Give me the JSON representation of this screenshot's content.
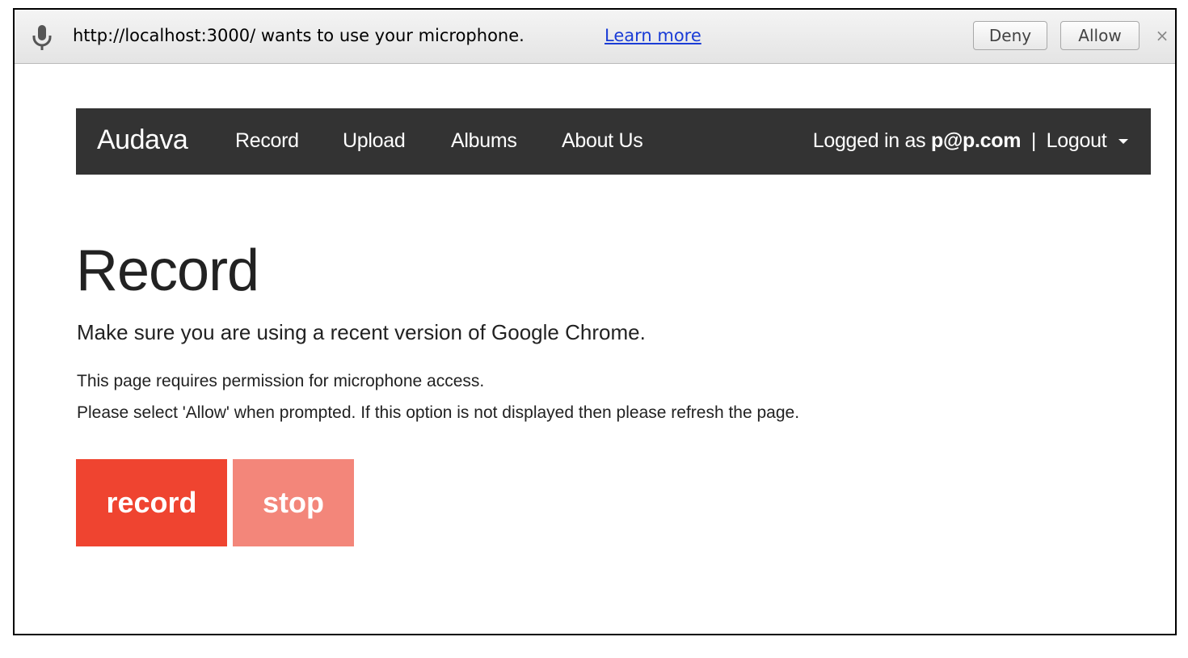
{
  "infobar": {
    "message": "http://localhost:3000/ wants to use your microphone.",
    "learn_more": "Learn more",
    "deny_label": "Deny",
    "allow_label": "Allow",
    "close_glyph": "×",
    "icon": "microphone-icon"
  },
  "navbar": {
    "brand": "Audava",
    "items": [
      "Record",
      "Upload",
      "Albums",
      "About Us"
    ],
    "logged_in_prefix": "Logged in as",
    "user_email": "p@p.com",
    "separator": "|",
    "logout_label": "Logout"
  },
  "main": {
    "title": "Record",
    "subtitle": "Make sure you are using a recent version of Google Chrome.",
    "note_line1": "This page requires permission for microphone access.",
    "note_line2": "Please select 'Allow' when prompted. If this option is not displayed then please refresh the page.",
    "record_label": "record",
    "stop_label": "stop"
  },
  "colors": {
    "navbar_bg": "#333333",
    "record_button": "#ef4430",
    "stop_button": "#f3867a",
    "link": "#1a3cd6"
  }
}
